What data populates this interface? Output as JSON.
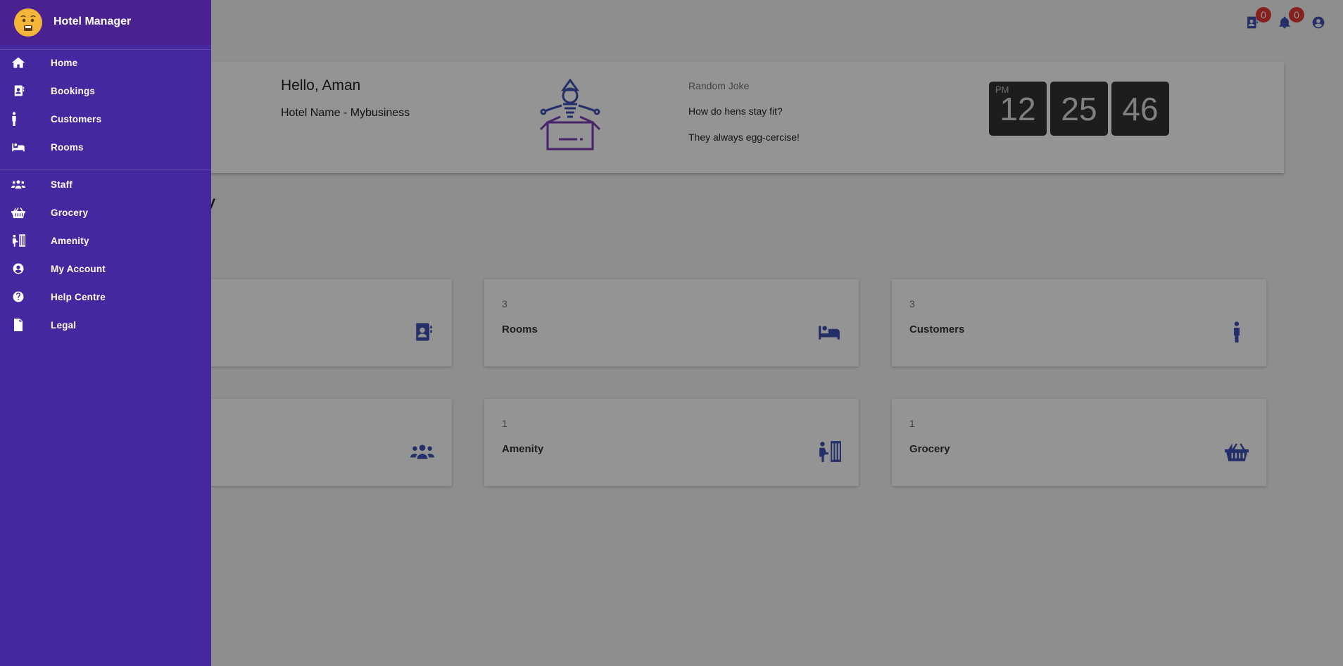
{
  "app": {
    "title": "Hotel Manager"
  },
  "drawer": {
    "items": [
      {
        "label": "Home",
        "icon": "home-icon"
      },
      {
        "label": "Bookings",
        "icon": "address-book-icon"
      },
      {
        "label": "Customers",
        "icon": "person-icon"
      },
      {
        "label": "Rooms",
        "icon": "bed-icon"
      },
      {
        "label": "Staff",
        "icon": "users-icon"
      },
      {
        "label": "Grocery",
        "icon": "basket-icon"
      },
      {
        "label": "Amenity",
        "icon": "luggage-icon"
      },
      {
        "label": "My Account",
        "icon": "user-circle-icon"
      },
      {
        "label": "Help Centre",
        "icon": "question-circle-icon"
      },
      {
        "label": "Legal",
        "icon": "document-icon"
      }
    ]
  },
  "topbar": {
    "bookings_badge": "0",
    "notifications_badge": "0",
    "icons": [
      "address-book-icon",
      "bell-icon",
      "user-circle-icon"
    ]
  },
  "hero": {
    "greeting": "Hello, Aman",
    "hotel_name": "Hotel Name - Mybusiness",
    "joke_title": "Random Joke",
    "joke_question": "How do hens stay fit?",
    "joke_answer": "They always egg-cercise!",
    "clock": {
      "ampm": "PM",
      "hours": "12",
      "minutes": "25",
      "seconds": "46"
    }
  },
  "overview": {
    "title_visible": "v",
    "cards": [
      {
        "count": "",
        "label": "",
        "icon": "address-book-icon"
      },
      {
        "count": "3",
        "label": "Rooms",
        "icon": "bed-icon"
      },
      {
        "count": "3",
        "label": "Customers",
        "icon": "person-icon"
      },
      {
        "count": "",
        "label": "",
        "icon": "users-icon"
      },
      {
        "count": "1",
        "label": "Amenity",
        "icon": "luggage-icon"
      },
      {
        "count": "1",
        "label": "Grocery",
        "icon": "basket-icon"
      }
    ]
  },
  "colors": {
    "drawer": "#4527a0",
    "drawer_header": "#4a2390",
    "accent": "#3f51b5",
    "badge": "#e53935",
    "clock_bg": "#333333"
  }
}
